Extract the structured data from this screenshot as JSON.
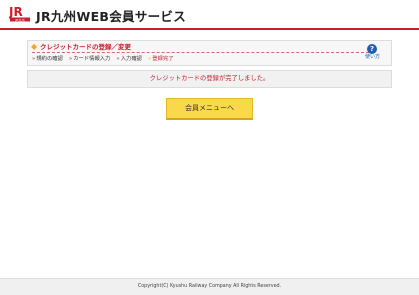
{
  "header": {
    "logo_text": "JR九州",
    "title": "JR九州WEB会員サービス",
    "accent_color": "#cc1f2d"
  },
  "panel": {
    "title": "クレジットカードの登録／変更",
    "steps": [
      {
        "label": "規約の確認",
        "current": false
      },
      {
        "label": "カード情報入力",
        "current": false
      },
      {
        "label": "入力確認",
        "current": false
      },
      {
        "label": "登録完了",
        "current": true
      }
    ],
    "help_label": "使い方",
    "help_icon": "question-icon"
  },
  "message": "クレジットカードの登録が完了しました。",
  "menu_button_label": "会員メニューへ",
  "footer": {
    "copyright": "Copyright(C) Kyushu Railway Company All Rights Reserved."
  }
}
